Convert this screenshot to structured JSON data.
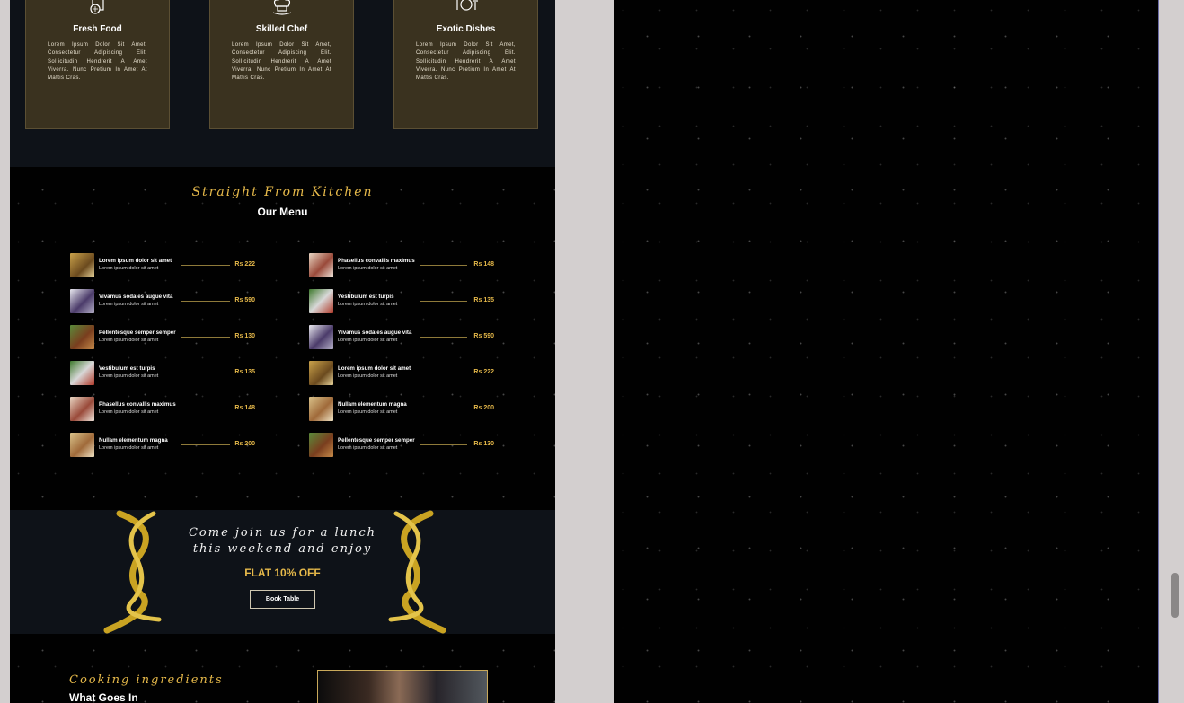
{
  "features": [
    {
      "icon": "fresh-food-icon",
      "title": "Fresh Food",
      "text": "Lorem Ipsum Dolor Sit Amet, Consectetur Adipiscing Elit. Sollicitudin Hendrerit A Amet Viverra. Nunc Pretium In Amet At Mattis Cras."
    },
    {
      "icon": "chef-hat-icon",
      "title": "Skilled Chef",
      "text": "Lorem Ipsum Dolor Sit Amet, Consectetur Adipiscing Elit. Sollicitudin Hendrerit A Amet Viverra. Nunc Pretium In Amet At Mattis Cras."
    },
    {
      "icon": "plate-cutlery-icon",
      "title": "Exotic Dishes",
      "text": "Lorem Ipsum Dolor Sit Amet, Consectetur Adipiscing Elit. Sollicitudin Hendrerit A Amet Viverra. Nunc Pretium In Amet At Mattis Cras."
    }
  ],
  "menu": {
    "kicker": "Straight From Kitchen",
    "heading": "Our Menu",
    "left": [
      {
        "name": "Lorem ipsum dolor sit amet",
        "desc": "Lorem ipsum dolor sit amet",
        "price": "Rs 222"
      },
      {
        "name": "Vivamus sodales augue vita",
        "desc": "Lorem ipsum dolor sit amet",
        "price": "Rs 590"
      },
      {
        "name": "Pellentesque semper semper",
        "desc": "Lorem ipsum dolor sit amet",
        "price": "Rs 130"
      },
      {
        "name": "Vestibulum est turpis",
        "desc": "Lorem ipsum dolor sit amet",
        "price": "Rs 135"
      },
      {
        "name": "Phasellus convallis maximus",
        "desc": "Lorem ipsum dolor sit amet",
        "price": "Rs 148"
      },
      {
        "name": "Nullam elementum magna",
        "desc": "Lorem ipsum dolor sit amet",
        "price": "Rs 200"
      }
    ],
    "right": [
      {
        "name": "Phasellus convallis maximus",
        "desc": "Lorem ipsum dolor sit amet",
        "price": "Rs 148"
      },
      {
        "name": "Vestibulum est turpis",
        "desc": "Lorem ipsum dolor sit amet",
        "price": "Rs 135"
      },
      {
        "name": "Vivamus sodales augue vita",
        "desc": "Lorem ipsum dolor sit amet",
        "price": "Rs 590"
      },
      {
        "name": "Lorem ipsum dolor sit amet",
        "desc": "Lorem ipsum dolor sit amet",
        "price": "Rs 222"
      },
      {
        "name": "Nullam elementum magna",
        "desc": "Lorem ipsum dolor sit amet",
        "price": "Rs 200"
      },
      {
        "name": "Pellentesque semper semper",
        "desc": "Lorem ipsum dolor sit amet",
        "price": "Rs 130"
      }
    ]
  },
  "offer": {
    "line1": "Come join us for a lunch",
    "line2": "this weekend and enjoy",
    "flat": "FLAT 10% OFF",
    "button": "Book Table"
  },
  "ingredients": {
    "kicker": "Cooking ingredients",
    "title": "What Goes In"
  },
  "colors": {
    "accent": "#e6b94a",
    "card": "#3a321f",
    "section": "#0e1218",
    "page": "#010101"
  }
}
